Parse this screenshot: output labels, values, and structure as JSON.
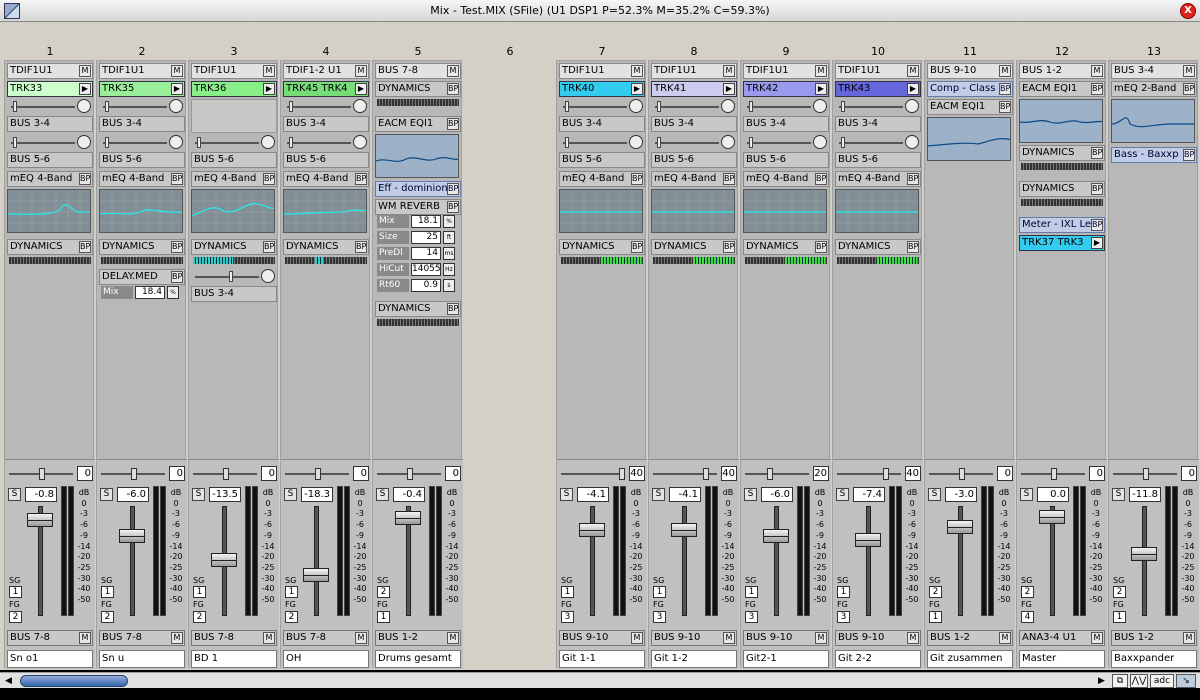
{
  "window": {
    "title": "Mix - Test.MIX (SFile) (U1 DSP1 P=52.3% M=35.2% C=59.3%)",
    "close_label": "X"
  },
  "channel_numbers": [
    "1",
    "2",
    "3",
    "4",
    "5",
    "6",
    "7",
    "8",
    "9",
    "10",
    "11",
    "12",
    "13"
  ],
  "channels": [
    {
      "input": "TDIF1U1",
      "mbtn": "M",
      "track": "TRK33",
      "send1": "BUS 3-4",
      "send2": "BUS 5-6",
      "eq": "mEQ 4-Band",
      "dyn": "DYNAMICS",
      "bp": "BP",
      "pan": "0",
      "vol": "-0.8",
      "sg": "1",
      "fg": "2",
      "out": "BUS 7-8",
      "name": "Sn o1"
    },
    {
      "input": "TDIF1U1",
      "mbtn": "M",
      "track": "TRK35",
      "send1": "BUS 3-4",
      "send2": "BUS 5-6",
      "eq": "mEQ 4-Band",
      "dyn": "DYNAMICS",
      "bp": "BP",
      "delay": "DELAY.MED",
      "mix_label": "Mix",
      "mix_value": "18.4",
      "mix_unit": "%",
      "pan": "0",
      "vol": "-6.0",
      "sg": "1",
      "fg": "2",
      "out": "BUS 7-8",
      "name": "Sn u"
    },
    {
      "input": "TDIF1U1",
      "mbtn": "M",
      "track": "TRK36",
      "send2": "BUS 5-6",
      "eq": "mEQ 4-Band",
      "dyn": "DYNAMICS",
      "bp": "BP",
      "send3": "BUS 3-4",
      "pan": "0",
      "vol": "-13.5",
      "sg": "1",
      "fg": "2",
      "out": "BUS 7-8",
      "name": "BD 1"
    },
    {
      "input": "TDIF1-2 U1",
      "mbtn": "M",
      "track": "TRK45 TRK4",
      "send1": "BUS 3-4",
      "send2": "BUS 5-6",
      "eq": "mEQ 4-Band",
      "dyn": "DYNAMICS",
      "bp": "BP",
      "pan": "0",
      "vol": "-18.3",
      "sg": "1",
      "fg": "2",
      "out": "BUS 7-8",
      "name": "OH"
    },
    {
      "input": "BUS 7-8",
      "mbtn": "M",
      "dyn": "DYNAMICS",
      "bp": "BP",
      "eqi": "EACM EQI1",
      "eff": "Eff - dominion",
      "reverb": "WM REVERB",
      "reverb_params": [
        {
          "label": "Mix",
          "value": "18.1",
          "unit": "%"
        },
        {
          "label": "Size",
          "value": "25",
          "unit": "ft"
        },
        {
          "label": "PreDl",
          "value": "14",
          "unit": "ms"
        },
        {
          "label": "HiCut",
          "value": "14055",
          "unit": "Hz"
        },
        {
          "label": "Rt60",
          "value": "0.9",
          "unit": "s"
        }
      ],
      "dyn2": "DYNAMICS",
      "pan": "0",
      "vol": "-0.4",
      "sg": "2",
      "fg": "1",
      "out": "BUS 1-2",
      "name": "Drums gesamt"
    },
    {
      "input": "TDIF1U1",
      "mbtn": "M",
      "track": "TRK40",
      "send1": "BUS 3-4",
      "send2": "BUS 5-6",
      "eq": "mEQ 4-Band",
      "dyn": "DYNAMICS",
      "bp": "BP",
      "pan": "40",
      "vol": "-4.1",
      "sg": "1",
      "fg": "3",
      "out": "BUS 9-10",
      "name": "Git 1-1"
    },
    {
      "input": "TDIF1U1",
      "mbtn": "M",
      "track": "TRK41",
      "send1": "BUS 3-4",
      "send2": "BUS 5-6",
      "eq": "mEQ 4-Band",
      "dyn": "DYNAMICS",
      "bp": "BP",
      "pan": "40",
      "vol": "-4.1",
      "sg": "1",
      "fg": "3",
      "out": "BUS 9-10",
      "name": "Git 1-2"
    },
    {
      "input": "TDIF1U1",
      "mbtn": "M",
      "track": "TRK42",
      "send1": "BUS 3-4",
      "send2": "BUS 5-6",
      "eq": "mEQ 4-Band",
      "dyn": "DYNAMICS",
      "bp": "BP",
      "pan": "20",
      "vol": "-6.0",
      "sg": "1",
      "fg": "3",
      "out": "BUS 9-10",
      "name": "Git2-1"
    },
    {
      "input": "TDIF1U1",
      "mbtn": "M",
      "track": "TRK43",
      "send1": "BUS 3-4",
      "send2": "BUS 5-6",
      "eq": "mEQ 4-Band",
      "dyn": "DYNAMICS",
      "bp": "BP",
      "pan": "40",
      "vol": "-7.4",
      "sg": "1",
      "fg": "3",
      "out": "BUS 9-10",
      "name": "Git 2-2"
    },
    {
      "input": "BUS 9-10",
      "mbtn": "M",
      "comp": "Comp - Class",
      "eqi": "EACM EQI1",
      "bp": "BP",
      "pan": "0",
      "vol": "-3.0",
      "sg": "2",
      "fg": "1",
      "out": "BUS 1-2",
      "name": "Git zusammen"
    },
    {
      "input": "BUS 1-2",
      "mbtn": "M",
      "eqi": "EACM EQI1",
      "dyn": "DYNAMICS",
      "dyn2": "DYNAMICS",
      "meter": "Meter - IXL Le",
      "track": "TRK37 TRK3",
      "bp": "BP",
      "pan": "0",
      "vol": "0.0",
      "sg": "2",
      "fg": "4",
      "out": "ANA3-4 U1",
      "name": "Master"
    },
    {
      "input": "BUS 3-4",
      "mbtn": "M",
      "eq": "mEQ 2-Band",
      "bass": "Bass - Baxxp",
      "bp": "BP",
      "pan": "0",
      "vol": "-11.8",
      "sg": "2",
      "fg": "1",
      "out": "BUS 1-2",
      "name": "Baxxpander"
    }
  ],
  "labels": {
    "sg": "SG",
    "fg": "FG",
    "s": "S",
    "db": "dB"
  },
  "db_scale": [
    "dB",
    "0",
    "-3",
    "-6",
    "-9",
    "-14",
    "-20",
    "-25",
    "-30",
    "-40",
    "-50"
  ],
  "fader_levels": [
    -0.8,
    -6.0,
    -13.5,
    -18.3,
    -0.4,
    -4.1,
    -4.1,
    -6.0,
    -7.4,
    -3.0,
    0.0,
    -11.8
  ],
  "track_colors": [
    "#ccffcc",
    "#99ee99",
    "#88ee88",
    "#77dd77",
    "#33ccee",
    "#ccccee",
    "#9999ee",
    "#6666dd"
  ],
  "scroll": {
    "left": "◀",
    "right": "▶",
    "btn1": "⧉",
    "btn2": "⋀⋁",
    "btn3": "adc",
    "btn4": "↘"
  }
}
